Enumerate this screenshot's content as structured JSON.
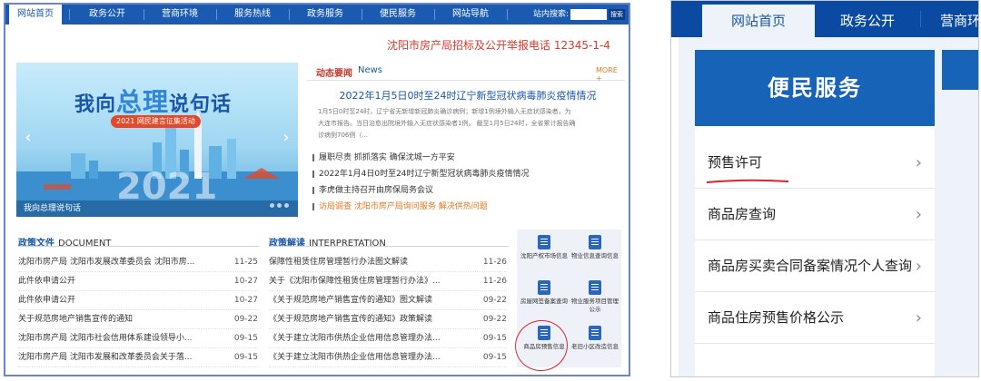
{
  "left": {
    "nav": {
      "items": [
        "网站首页",
        "政务公开",
        "营商环境",
        "服务热线",
        "政务服务",
        "便民服务",
        "网站导航"
      ],
      "search_label": "站内搜索:",
      "search_button": "搜索"
    },
    "hotline": "沈阳市房产局招标及公开举报电话 12345-1-4",
    "banner": {
      "title_a": "我向",
      "title_big": "总理",
      "title_b": "说句话",
      "badge": "2021 网民建言征集活动",
      "caption": "我向总理说句话"
    },
    "news": {
      "header_cn": "动态要闻",
      "header_en": "News",
      "more": "MORE +",
      "headline": "2022年1月5日0时至24时辽宁新型冠状病毒肺炎疫情情况",
      "summary": [
        "1月5日0时至24时，辽宁省无新增新冠肺炎确诊病例；新增1例境外输入无症状感染者，为",
        "大连市报告。当日治愈出院境外输入无症状感染者1例。   截至1月5日24时，全省累计报告确",
        "诊病例706例（..."
      ],
      "items": [
        "履职尽责 抓抓落实 确保沈城一方平安",
        "2022年1月4日0时至24时辽宁新型冠状病毒肺炎疫情情况",
        "李虎做主持召开由房保局务会议",
        "访局调查 沈阳市房产局询问服务 解决供热问题"
      ]
    },
    "policy_docs": {
      "header_cn": "政策文件",
      "header_en": "DOCUMENT",
      "rows": [
        {
          "title": "沈阳市房产局 沈阳市发展改革委员会 沈阳市房...",
          "date": "11-25"
        },
        {
          "title": "此件依申请公开",
          "date": "10-27"
        },
        {
          "title": "此件依申请公开",
          "date": "10-27"
        },
        {
          "title": "关于规范房地产销售宣传的通知",
          "date": "09-22"
        },
        {
          "title": "沈阳市房产局 沈阳市社会信用体系建设领导小...",
          "date": "09-15"
        },
        {
          "title": "沈阳市房产局 沈阳市发展和改革委员会关于落...",
          "date": "09-15"
        }
      ]
    },
    "policy_interp": {
      "header_cn": "政策解读",
      "header_en": "INTERPRETATION",
      "rows": [
        {
          "title": "保障性租赁住房管理暂行办法图文解读",
          "date": "11-26"
        },
        {
          "title": "关于《沈阳市保障性租赁住房管理暂行办法》...",
          "date": "11-26"
        },
        {
          "title": "《关于规范房地产销售宣传的通知》图文解读",
          "date": "09-22"
        },
        {
          "title": "《关于规范房地产销售宣传的通知》政策解读",
          "date": "09-22"
        },
        {
          "title": "《关于建立沈阳市供热企业信用信息管理办法...",
          "date": "09-15"
        },
        {
          "title": "《关于建立沈阳市供热企业信用信息管理办法...",
          "date": "09-15"
        }
      ]
    },
    "services": [
      "沈阳产权市场信息",
      "物业信息查询信息",
      "房屋网签备案查询",
      "物业服务项目管理公示",
      "商品房预售信息",
      "老旧小区改造信息"
    ]
  },
  "right": {
    "tabs": [
      "网站首页",
      "政务公开",
      "营商环境"
    ],
    "header": "便民服务",
    "items": [
      "预售许可",
      "商品房查询",
      "商品房买卖合同备案情况个人查询",
      "商品住房预售价格公示"
    ],
    "chevron": "›"
  },
  "colors": {
    "nav_blue": "#1a5ab0",
    "header_blue": "#1763b8",
    "hotline_red": "#d63a2a",
    "annotation_red": "#d7262b",
    "more_orange": "#e07a20"
  }
}
